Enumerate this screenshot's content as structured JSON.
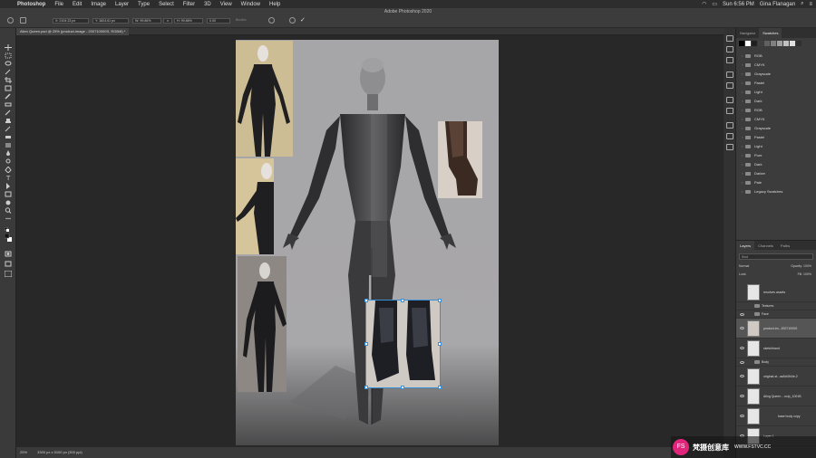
{
  "mac_menu": {
    "app": "Photoshop",
    "items": [
      "File",
      "Edit",
      "Image",
      "Layer",
      "Type",
      "Select",
      "Filter",
      "3D",
      "View",
      "Window",
      "Help"
    ],
    "clock": "Sun 6:56 PM",
    "user": "Gina Flanagan"
  },
  "window_title": "Adobe Photoshop 2020",
  "options": {
    "x": "X: 2104.33 px",
    "y": "Y: 3824.61 px",
    "w": "W: 99.86%",
    "h": "H: 99.86%",
    "angle": "0.00",
    "interp": "Bicubic"
  },
  "document_tab": "Alien Queen.psd @ 25% (product-image - 200710000S, RGB/8) *",
  "status": {
    "zoom": "25%",
    "doc_size": "3300 px x 5100 px (300 ppi)"
  },
  "swatches_panel": {
    "tabs": [
      "Navigator",
      "Swatches"
    ],
    "active_tab": "Swatches",
    "swatch_colors": [
      "#000000",
      "#ffffff",
      "#202020",
      "#404040",
      "#606060",
      "#808080",
      "#a0a0a0",
      "#c0c0c0",
      "#e0e0e0",
      "#303030"
    ],
    "folders": [
      "RGB",
      "CMYK",
      "Grayscale",
      "Pastel",
      "Light",
      "Dark",
      "RGB",
      "CMYK",
      "Grayscale",
      "Pastel",
      "Light",
      "Pure",
      "Dark",
      "Darker",
      "Pale",
      "Legacy Swatches"
    ]
  },
  "layers_panel": {
    "tabs": [
      "Layers",
      "Channels",
      "Paths"
    ],
    "active_tab": "Layers",
    "filter_label": "Kind",
    "blend_mode": "Normal",
    "opacity": "Opacity: 100%",
    "lock_label": "Lock:",
    "fill": "Fill: 100%",
    "layers": [
      {
        "name": "resolves assets",
        "type": "layer"
      },
      {
        "name": "Textures",
        "type": "group"
      },
      {
        "name": "Face",
        "type": "group"
      },
      {
        "name": "product-im...20071000S",
        "type": "layer",
        "selected": true
      },
      {
        "name": "sketchhand",
        "type": "layer"
      },
      {
        "name": "Body",
        "type": "group"
      },
      {
        "name": "original-st...aa5d4f44e-2",
        "type": "layer"
      },
      {
        "name": "Aling Queen ...ncip_1001B",
        "type": "layer"
      },
      {
        "name": "base body copy",
        "type": "layer"
      },
      {
        "name": "Layer 1",
        "type": "layer"
      }
    ]
  },
  "watermark": {
    "logo": "FS",
    "text": "梵摄创意库",
    "url": "WWW.FSTVC.CC"
  }
}
